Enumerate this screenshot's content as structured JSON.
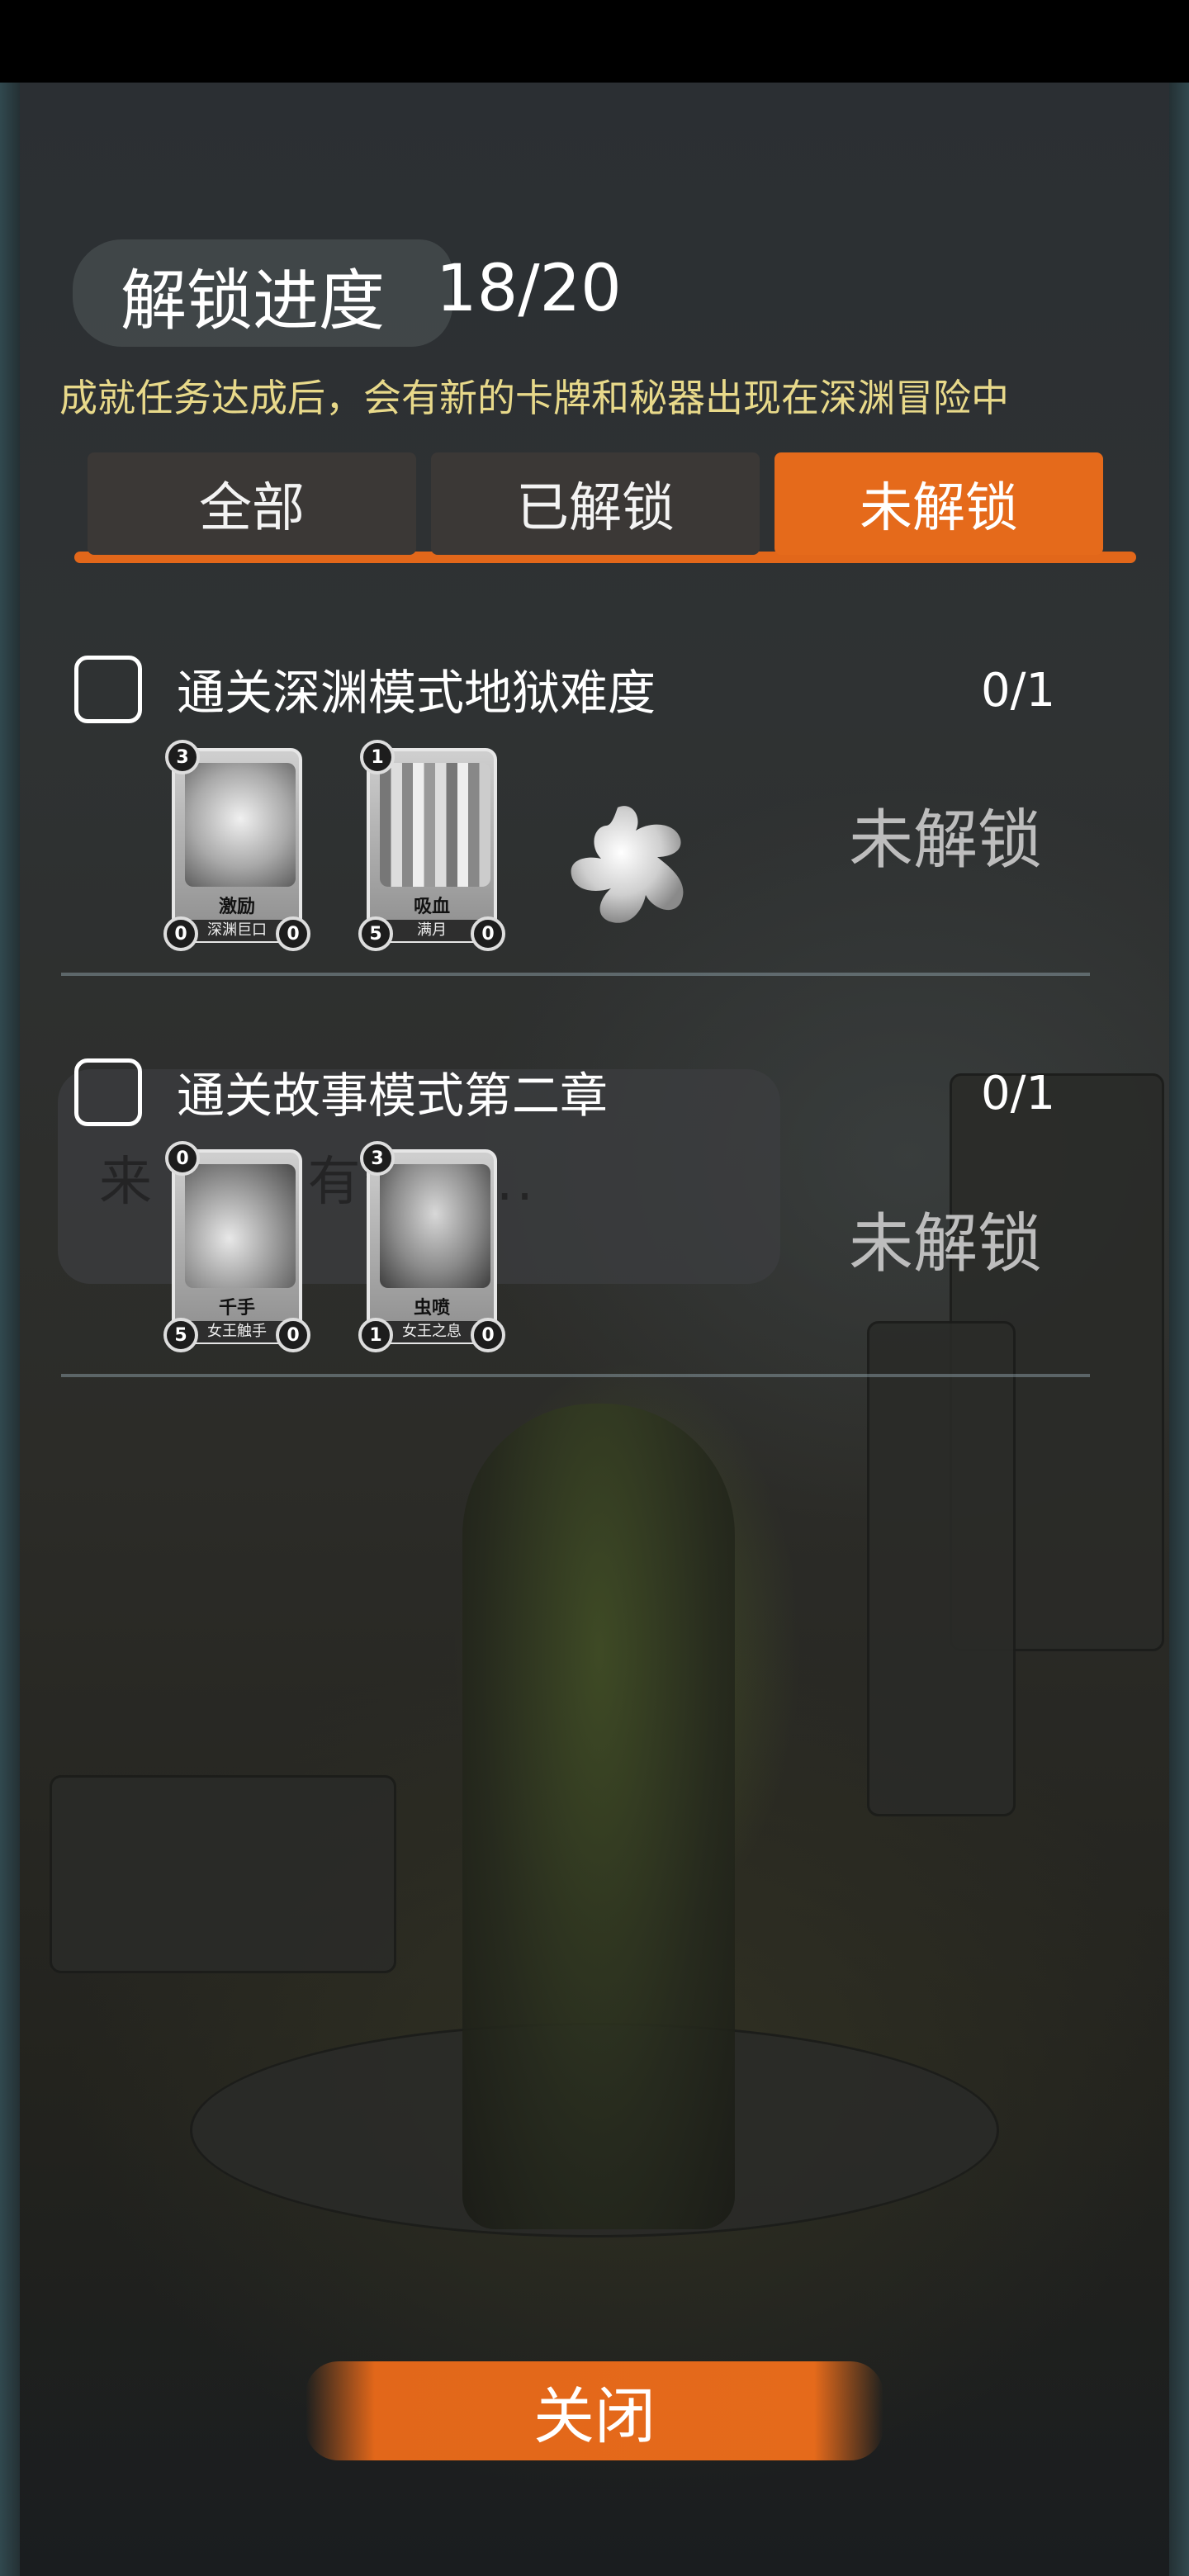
{
  "header": {
    "progress_label": "解锁进度",
    "progress_value": "18/20",
    "hint": "成就任务达成后，会有新的卡牌和秘器出现在深渊冒险中"
  },
  "tabs": [
    {
      "label": "全部",
      "active": false
    },
    {
      "label": "已解锁",
      "active": false
    },
    {
      "label": "未解锁",
      "active": true
    }
  ],
  "tasks": [
    {
      "title": "通关深渊模式地狱难度",
      "count": "0/1",
      "status": "未解锁",
      "cards": [
        {
          "name": "激励",
          "subtitle": "深渊巨口",
          "cost": "3",
          "attack": "0",
          "health": "0"
        },
        {
          "name": "吸血",
          "subtitle": "满月",
          "cost": "1",
          "attack": "5",
          "health": "0"
        }
      ],
      "relic_icon": "splash-relic-icon"
    },
    {
      "title": "通关故事模式第二章",
      "count": "0/1",
      "status": "未解锁",
      "cards": [
        {
          "name": "千手",
          "subtitle": "女王触手",
          "cost": "0",
          "attack": "5",
          "health": "0"
        },
        {
          "name": "虫喷",
          "subtitle": "女王之息",
          "cost": "3",
          "attack": "1",
          "health": "0"
        }
      ]
    }
  ],
  "background_chat": {
    "text": "来     来     你有什么..."
  },
  "close_label": "关闭",
  "colors": {
    "accent": "#e56a1b",
    "hint": "#e8d98a",
    "tab_inactive": "#3b3836"
  }
}
